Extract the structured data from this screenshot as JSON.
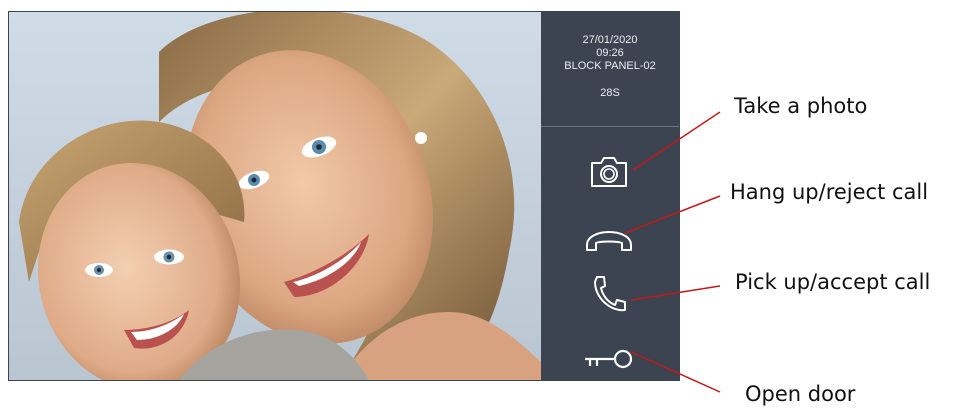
{
  "status": {
    "date": "27/01/2020",
    "time": "09:26",
    "panel_name": "BLOCK PANEL-02",
    "call_duration": "28S"
  },
  "buttons": [
    {
      "icon": "camera-icon",
      "action": "Take a photo"
    },
    {
      "icon": "hang-up-icon",
      "action": "Hang up/reject call"
    },
    {
      "icon": "pick-up-icon",
      "action": "Pick up/accept call"
    },
    {
      "icon": "key-icon",
      "action": "Open door"
    }
  ],
  "callouts": {
    "take_photo": "Take a photo",
    "hang_up": "Hang up/reject call",
    "pick_up": "Pick up/accept call",
    "open_door": "Open door"
  },
  "colors": {
    "panel_bg": "#3b4450",
    "panel_text": "#e8eef4",
    "leader_line": "#c21a1a"
  }
}
